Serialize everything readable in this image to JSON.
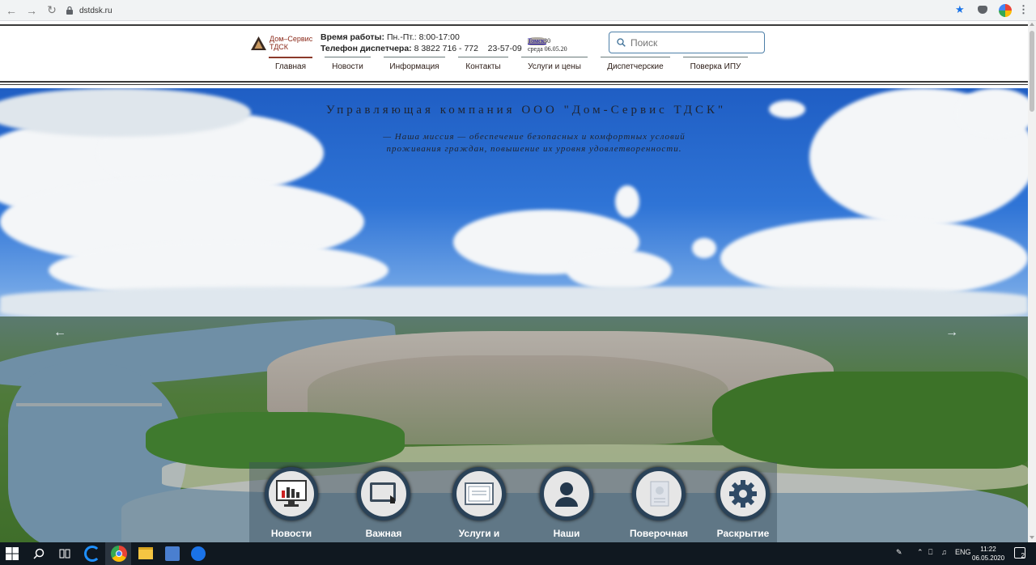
{
  "browser": {
    "url": "dstdsk.ru"
  },
  "header": {
    "logo_text_line1": "Дом–Сервис",
    "logo_text_line2": "ТДСК",
    "hours_label": "Время работы:",
    "hours_value": "Пн.-Пт.: 8:00-17:00",
    "phone_label": "Телефон диспетчера:",
    "phone_values": "8 3822 716 - 772    23-57-09",
    "clock_city": "Томск:",
    "clock_time": "11:21:30",
    "clock_date": "среда 06.05.20",
    "search_placeholder": "Поиск"
  },
  "nav": {
    "items": [
      {
        "label": "Главная",
        "active": true
      },
      {
        "label": "Новости"
      },
      {
        "label": "Информация"
      },
      {
        "label": "Контакты"
      },
      {
        "label": "Услуги и цены"
      },
      {
        "label": "Диспетчерские"
      },
      {
        "label": "Поверка ИПУ"
      }
    ]
  },
  "hero": {
    "title": "Управляющая компания ООО \"Дом-Сервис ТДСК\"",
    "mission_line1": "— Наша миссия — обеспечение безопасных и комфортных условий",
    "mission_line2": "проживания граждан, повышение их уровня удовлетворенности.",
    "prev_arrow": "←",
    "next_arrow": "→"
  },
  "tiles": [
    {
      "label": "Новости",
      "icon": "monitor-chart-icon"
    },
    {
      "label": "Важная",
      "icon": "tablet-touch-icon"
    },
    {
      "label": "Услуги и",
      "icon": "certificate-icon"
    },
    {
      "label": "Наши",
      "icon": "person-icon"
    },
    {
      "label": "Поверочная",
      "icon": "document-icon"
    },
    {
      "label": "Раскрытие",
      "icon": "gear-icon"
    }
  ],
  "taskbar": {
    "lang": "ENG",
    "time": "11:22",
    "date": "06.05.2020",
    "notifications": "2"
  },
  "colors": {
    "brand": "#8b2a1a",
    "nav_text": "#2a1a14",
    "search_border": "#4d7fa8"
  }
}
